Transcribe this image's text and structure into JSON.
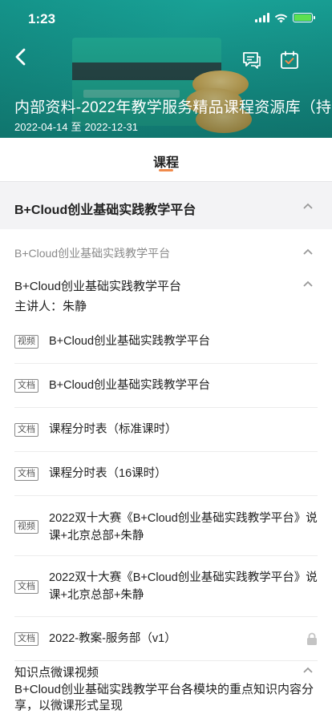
{
  "status_bar": {
    "time": "1:23"
  },
  "header": {
    "title": "内部资料-2022年教学服务精品课程资源库（持…",
    "date_start": "2022-04-14",
    "date_sep": "至",
    "date_end": "2022-12-31",
    "icons": [
      "back-arrow-icon",
      "chat-icon",
      "calendar-check-icon"
    ]
  },
  "tabs": [
    {
      "label": "课程",
      "active": true
    }
  ],
  "chapter": {
    "title": "B+Cloud创业基础实践教学平台",
    "expanded": true
  },
  "section": {
    "title": "B+Cloud创业基础实践教学平台",
    "expanded": true
  },
  "lesson": {
    "title": "B+Cloud创业基础实践教学平台",
    "speaker": "主讲人：朱静",
    "expanded": true
  },
  "items": [
    {
      "tag": "视频",
      "label": "B+Cloud创业基础实践教学平台"
    },
    {
      "tag": "文档",
      "label": "B+Cloud创业基础实践教学平台"
    },
    {
      "tag": "文档",
      "label": "课程分时表（标准课时）"
    },
    {
      "tag": "文档",
      "label": "课程分时表（16课时）"
    },
    {
      "tag": "视频",
      "label_line1": "2022双十大赛《B+Cloud创业基础实践教学平台》说",
      "label_line2": "课+北京总部+朱静"
    },
    {
      "tag": "文档",
      "label_line1": "2022双十大赛《B+Cloud创业基础实践教学平台》说",
      "label_line2": "课+北京总部+朱静"
    },
    {
      "tag": "文档",
      "label": "2022-教案-服务部（v1）",
      "locked": true
    }
  ],
  "knowledge": {
    "title": "知识点微课视频",
    "desc": "B+Cloud创业基础实践教学平台各模块的重点知识内容分享，以微课形式呈现"
  },
  "colors": {
    "accent": "#1aa89c",
    "tab_indicator": "#f08a4b",
    "battery": "#5ee04f"
  }
}
